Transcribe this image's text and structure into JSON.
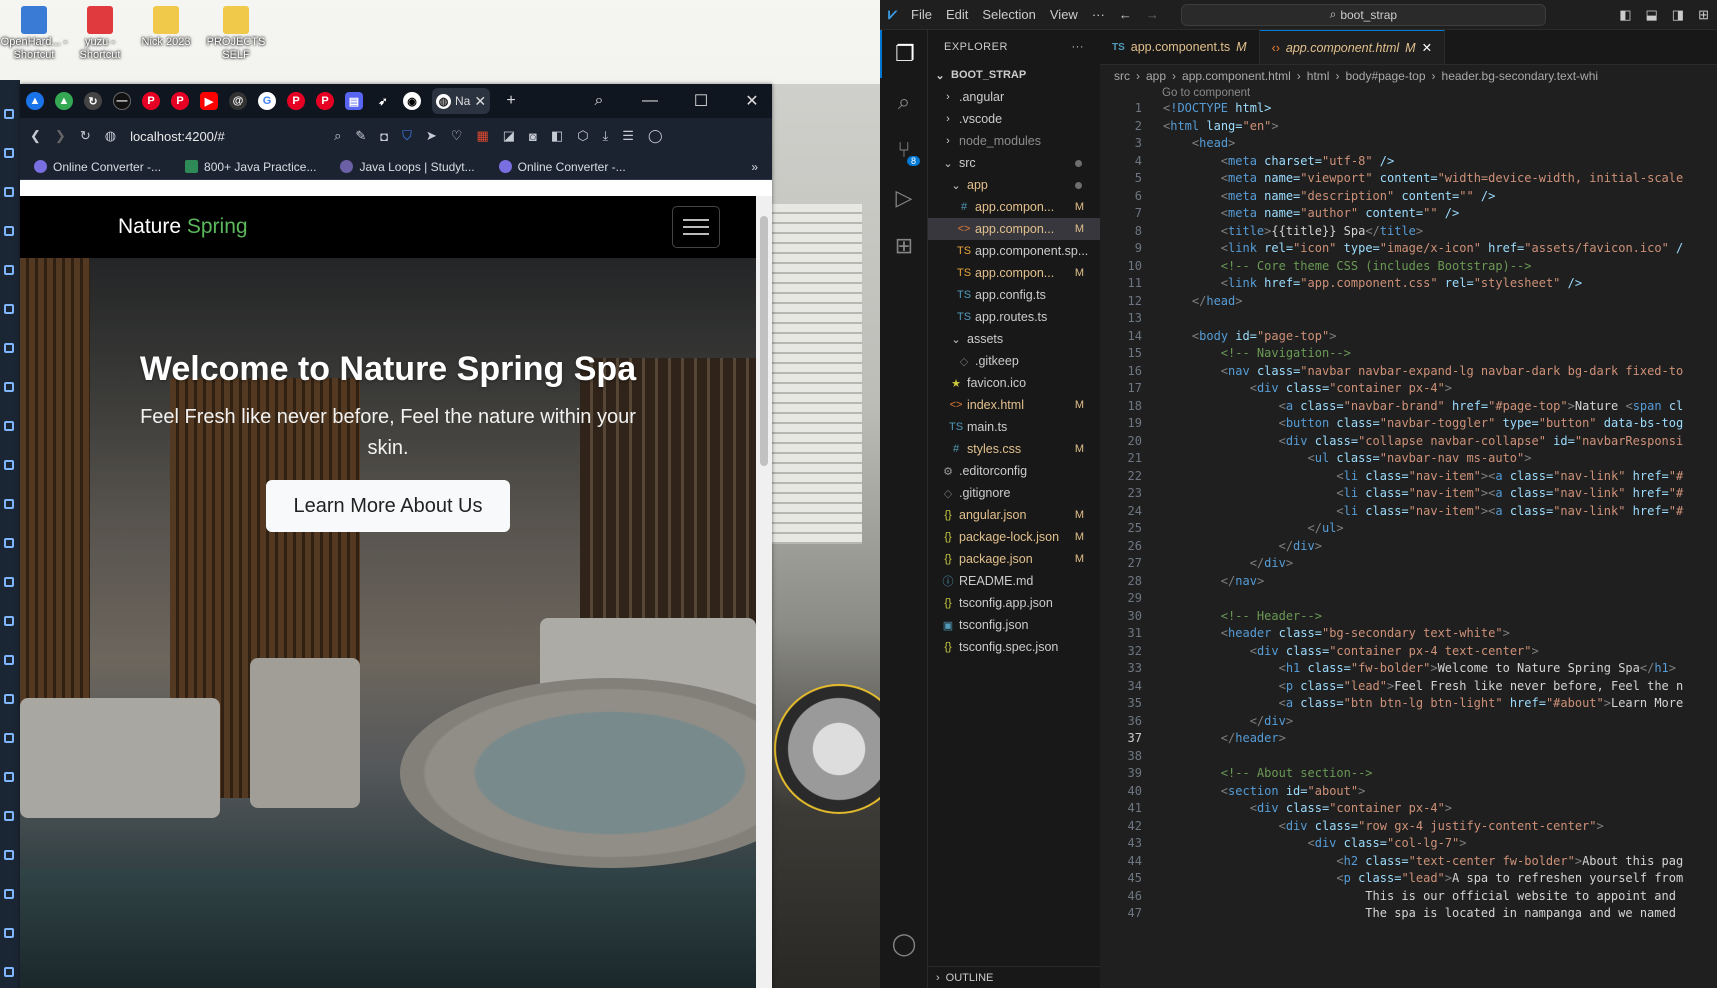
{
  "desktop": {
    "icons": [
      {
        "label": "OpenHard... - Shortcut",
        "color": "#3a7bd5"
      },
      {
        "label": "yuzu - Shortcut",
        "color": "#e0393e"
      },
      {
        "label": "Nick 2023",
        "color": "#f0c84a"
      },
      {
        "label": "PROJECTS SELF",
        "color": "#f0c84a"
      }
    ]
  },
  "browser": {
    "active_tab_title": "Na",
    "url": "localhost:4200/#",
    "bookmarks": [
      "Online Converter -...",
      "800+ Java Practice...",
      "Java Loops | Studyt...",
      "Online Converter -..."
    ],
    "site": {
      "brand_text": "Nature",
      "brand_accent": "Spring",
      "hero_title": "Welcome to Nature Spring Spa",
      "hero_lead": "Feel Fresh like never before, Feel the nature within your skin.",
      "hero_button": "Learn More About Us"
    }
  },
  "vscode": {
    "menu": [
      "File",
      "Edit",
      "Selection",
      "View",
      "···"
    ],
    "search": "boot_strap",
    "explorer_title": "EXPLORER",
    "root": "BOOT_STRAP",
    "source_control_badge": "8",
    "tree": [
      {
        "label": ".angular",
        "icon": "›",
        "indent": 1,
        "color": "#ccc"
      },
      {
        "label": ".vscode",
        "icon": "›",
        "indent": 1,
        "color": "#ccc"
      },
      {
        "label": "node_modules",
        "icon": "›",
        "indent": 1,
        "color": "#8c8c8c"
      },
      {
        "label": "src",
        "icon": "⌄",
        "indent": 1,
        "color": "#ccc",
        "dot": true
      },
      {
        "label": "app",
        "icon": "⌄",
        "indent": 2,
        "color": "#e2c08d",
        "dot": true
      },
      {
        "label": "app.compon...",
        "icon": "#",
        "indent": 3,
        "color": "#e2c08d",
        "status": "M",
        "iconColor": "#519aba"
      },
      {
        "label": "app.compon...",
        "icon": "<>",
        "indent": 3,
        "color": "#e2c08d",
        "status": "M",
        "iconColor": "#e37933",
        "selected": true
      },
      {
        "label": "app.component.sp...",
        "icon": "TS",
        "indent": 3,
        "color": "#ccc",
        "iconColor": "#e8a33d"
      },
      {
        "label": "app.compon...",
        "icon": "TS",
        "indent": 3,
        "color": "#e2c08d",
        "status": "M",
        "iconColor": "#e8a33d"
      },
      {
        "label": "app.config.ts",
        "icon": "TS",
        "indent": 3,
        "color": "#ccc",
        "iconColor": "#519aba"
      },
      {
        "label": "app.routes.ts",
        "icon": "TS",
        "indent": 3,
        "color": "#ccc",
        "iconColor": "#519aba"
      },
      {
        "label": "assets",
        "icon": "⌄",
        "indent": 2,
        "color": "#ccc"
      },
      {
        "label": ".gitkeep",
        "icon": "◇",
        "indent": 3,
        "color": "#ccc",
        "iconColor": "#6d6d6d"
      },
      {
        "label": "favicon.ico",
        "icon": "★",
        "indent": 2,
        "color": "#ccc",
        "iconColor": "#cbcb41"
      },
      {
        "label": "index.html",
        "icon": "<>",
        "indent": 2,
        "color": "#e2c08d",
        "status": "M",
        "iconColor": "#e37933"
      },
      {
        "label": "main.ts",
        "icon": "TS",
        "indent": 2,
        "color": "#ccc",
        "iconColor": "#519aba"
      },
      {
        "label": "styles.css",
        "icon": "#",
        "indent": 2,
        "color": "#e2c08d",
        "status": "M",
        "iconColor": "#519aba"
      },
      {
        "label": ".editorconfig",
        "icon": "⚙",
        "indent": 1,
        "color": "#ccc",
        "iconColor": "#999"
      },
      {
        "label": ".gitignore",
        "icon": "◇",
        "indent": 1,
        "color": "#ccc",
        "iconColor": "#6d6d6d"
      },
      {
        "label": "angular.json",
        "icon": "{}",
        "indent": 1,
        "color": "#e2c08d",
        "status": "M",
        "iconColor": "#cbcb41"
      },
      {
        "label": "package-lock.json",
        "icon": "{}",
        "indent": 1,
        "color": "#e2c08d",
        "status": "M",
        "iconColor": "#cbcb41"
      },
      {
        "label": "package.json",
        "icon": "{}",
        "indent": 1,
        "color": "#e2c08d",
        "status": "M",
        "iconColor": "#cbcb41"
      },
      {
        "label": "README.md",
        "icon": "ⓘ",
        "indent": 1,
        "color": "#ccc",
        "iconColor": "#519aba"
      },
      {
        "label": "tsconfig.app.json",
        "icon": "{}",
        "indent": 1,
        "color": "#ccc",
        "iconColor": "#cbcb41"
      },
      {
        "label": "tsconfig.json",
        "icon": "▣",
        "indent": 1,
        "color": "#ccc",
        "iconColor": "#519aba"
      },
      {
        "label": "tsconfig.spec.json",
        "icon": "{}",
        "indent": 1,
        "color": "#ccc",
        "iconColor": "#cbcb41"
      }
    ],
    "outline_label": "OUTLINE",
    "tabs": [
      {
        "icon": "TS",
        "label": "app.component.ts",
        "status": "M",
        "active": false
      },
      {
        "icon": "<>",
        "label": "app.component.html",
        "status": "M",
        "active": true
      }
    ],
    "breadcrumbs": [
      "src",
      "app",
      "app.component.html",
      "html",
      "body#page-top",
      "header.bg-secondary.text-whi"
    ],
    "codelens": "Go to component",
    "current_line": 37,
    "code": [
      "<!DOCTYPE html>",
      "<html lang=\"en\">",
      "    <head>",
      "        <meta charset=\"utf-8\" />",
      "        <meta name=\"viewport\" content=\"width=device-width, initial-scale",
      "        <meta name=\"description\" content=\"\" />",
      "        <meta name=\"author\" content=\"\" />",
      "        <title>{{title}} Spa</title>",
      "        <link rel=\"icon\" type=\"image/x-icon\" href=\"assets/favicon.ico\" /",
      "        <!-- Core theme CSS (includes Bootstrap)-->",
      "        <link href=\"app.component.css\" rel=\"stylesheet\" />",
      "    </head>",
      "",
      "    <body id=\"page-top\">",
      "        <!-- Navigation-->",
      "        <nav class=\"navbar navbar-expand-lg navbar-dark bg-dark fixed-to",
      "            <div class=\"container px-4\">",
      "                <a class=\"navbar-brand\" href=\"#page-top\">Nature <span cl",
      "                <button class=\"navbar-toggler\" type=\"button\" data-bs-tog",
      "                <div class=\"collapse navbar-collapse\" id=\"navbarResponsi",
      "                    <ul class=\"navbar-nav ms-auto\">",
      "                        <li class=\"nav-item\"><a class=\"nav-link\" href=\"#",
      "                        <li class=\"nav-item\"><a class=\"nav-link\" href=\"#",
      "                        <li class=\"nav-item\"><a class=\"nav-link\" href=\"#",
      "                    </ul>",
      "                </div>",
      "            </div>",
      "        </nav>",
      "",
      "        <!-- Header-->",
      "        <header class=\"bg-secondary text-white\">",
      "            <div class=\"container px-4 text-center\">",
      "                <h1 class=\"fw-bolder\">Welcome to Nature Spring Spa</h1>",
      "                <p class=\"lead\">Feel Fresh like never before, Feel the n",
      "                <a class=\"btn btn-lg btn-light\" href=\"#about\">Learn More",
      "            </div>",
      "        </header>",
      "",
      "        <!-- About section-->",
      "        <section id=\"about\">",
      "            <div class=\"container px-4\">",
      "                <div class=\"row gx-4 justify-content-center\">",
      "                    <div class=\"col-lg-7\">",
      "                        <h2 class=\"text-center fw-bolder\">About this pag",
      "                        <p class=\"lead\">A spa to refreshen yourself from",
      "                            This is our official website to appoint and",
      "                            The spa is located in nampanga and we named"
    ]
  }
}
